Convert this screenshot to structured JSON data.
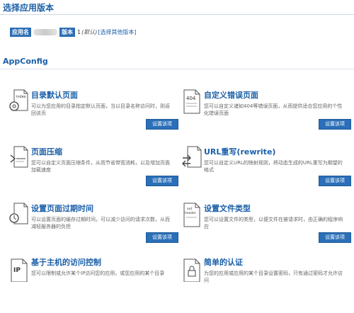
{
  "header": {
    "title": "选择应用版本"
  },
  "app": {
    "name_label": "应用名",
    "version_label": "版本",
    "version_value": "1",
    "default_text": "(默认)",
    "select_link": "[选择其他版本]"
  },
  "appconfig": {
    "title": "AppConfig"
  },
  "cards": [
    {
      "title": "目录默认页面",
      "desc": "可以为您应用的目录指定默认页面，当以目录名称访问时，则返回该页",
      "button": "设置该项",
      "icon": "index-page-gear-icon"
    },
    {
      "title": "自定义错误页面",
      "desc": "您可以自定义诸如404等错误页面，从而提供适合您应用的个性化错误页面",
      "button": "设置该项",
      "icon": "404-page-icon"
    },
    {
      "title": "页面压缩",
      "desc": "您可以自定义页面压缩条件，从而节省带宽消耗，以及增加页面加载速度",
      "button": "设置该项",
      "icon": "compress-page-icon"
    },
    {
      "title": "URL重写(rewrite)",
      "desc": "您可以自定义URL的映射规则，将动态生成的URL重写为期望的格式",
      "button": "设置该项",
      "icon": "url-rewrite-page-icon"
    },
    {
      "title": "设置页面过期时间",
      "desc": "可以设置页面的缓存过期时间，可以减少访问的请求次数，从而减轻服务器的负担",
      "button": "设置该项",
      "icon": "expire-clock-page-icon"
    },
    {
      "title": "设置文件类型",
      "desc": "您可以设置文件的类型，以便文件在被请求时，由正确的程序响应",
      "button": "设置该项",
      "icon": "out-header-page-icon"
    },
    {
      "title": "基于主机的访问控制",
      "desc": "您可以限制或允许某个IP访问您的应用，或您应用的某个目录",
      "button": "",
      "icon": "ip-page-icon"
    },
    {
      "title": "简单的认证",
      "desc": "为您的应用或应用的某个目录设置密码，只有通过密码才允许访问",
      "button": "",
      "icon": "auth-page-icon"
    }
  ]
}
